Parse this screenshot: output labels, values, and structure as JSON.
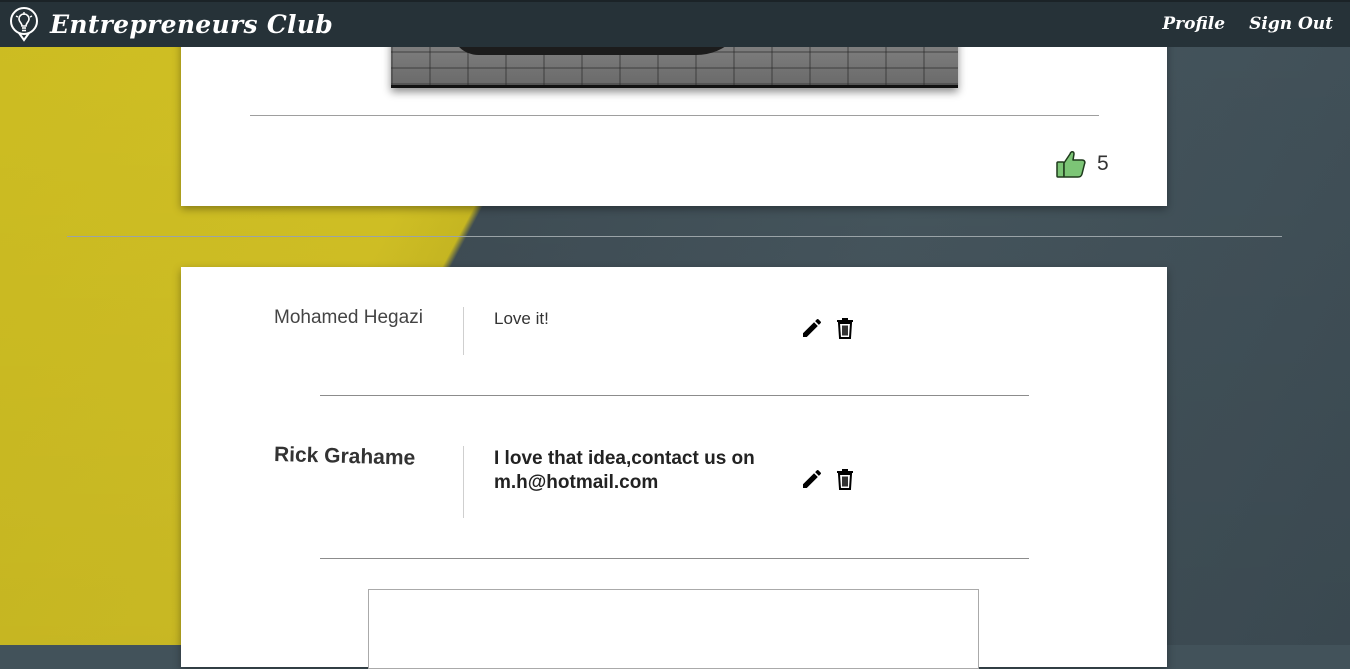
{
  "navbar": {
    "brand": "Entrepreneurs Club",
    "brand_icon": "lightbulb-icon",
    "links": [
      {
        "label": "Profile"
      },
      {
        "label": "Sign Out"
      }
    ]
  },
  "post": {
    "like_icon": "thumbs-up-icon",
    "like_count": "5"
  },
  "comments": [
    {
      "author": "Mohamed Hegazi",
      "text": "Love it!"
    },
    {
      "author": "Rick Grahame",
      "text": "I love that idea,contact us on m.h@hotmail.com"
    }
  ],
  "comment_input": {
    "value": ""
  },
  "colors": {
    "navbar": "#263238",
    "background_yellow": "#d2c125",
    "background_slate": "#42525a",
    "like_green": "#7cc576"
  }
}
